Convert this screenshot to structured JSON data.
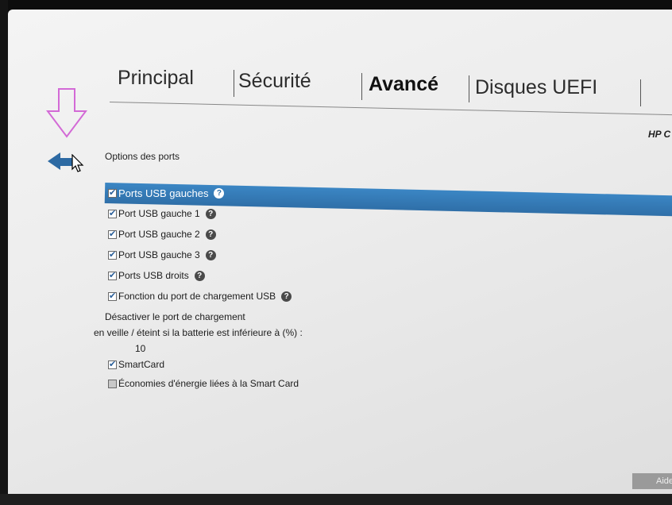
{
  "tabs": [
    {
      "label": "Principal",
      "active": false
    },
    {
      "label": "Sécurité",
      "active": false
    },
    {
      "label": "Avancé",
      "active": true
    },
    {
      "label": "Disques UEFI",
      "active": false
    }
  ],
  "brand": "HP C",
  "section_title": "Options des ports",
  "options": [
    {
      "label": "Ports USB gauches",
      "checked": true,
      "help": true,
      "selected": true
    },
    {
      "label": "Port USB gauche 1",
      "checked": true,
      "help": true
    },
    {
      "label": "Port USB gauche 2",
      "checked": true,
      "help": true
    },
    {
      "label": "Port USB gauche 3",
      "checked": true,
      "help": true
    },
    {
      "label": "Ports USB droits",
      "checked": true,
      "help": true
    },
    {
      "label": "Fonction du port de chargement USB",
      "checked": true,
      "help": true
    }
  ],
  "charging": {
    "line1": "Désactiver le port de chargement",
    "line2": "en veille / éteint si la batterie est inférieure à (%) :",
    "value": "10"
  },
  "smartcard": {
    "label": "SmartCard",
    "checked": true
  },
  "smartcard_power": {
    "label": "Économies d'énergie liées à la Smart Card",
    "checked": false
  },
  "help_glyph": "?",
  "aide_label": "Aide",
  "colors": {
    "highlight": "#2f6fa8",
    "annotation": "#d36ad6",
    "back_arrow": "#2d6aa3"
  }
}
